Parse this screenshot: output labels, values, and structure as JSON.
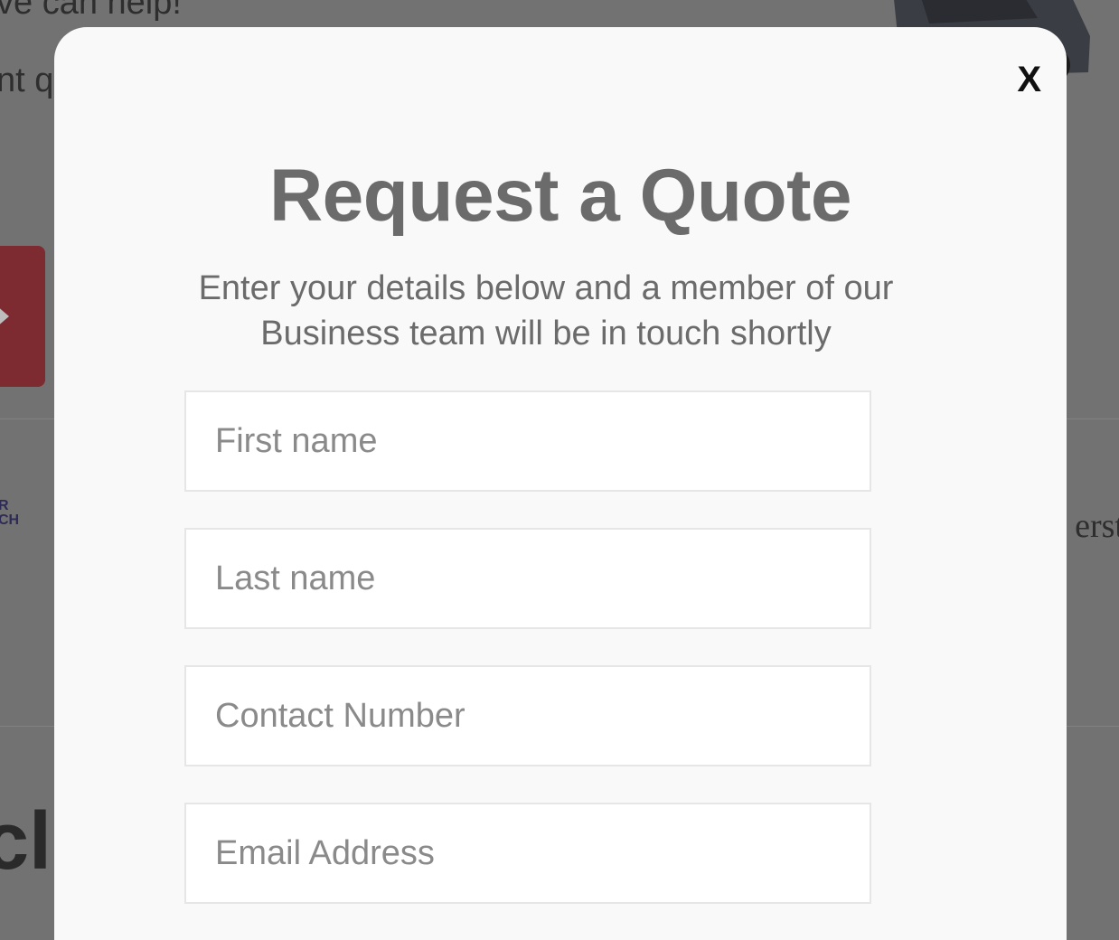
{
  "background": {
    "top_text": "ve can help!",
    "mid_text": "nt qu",
    "logo_lines": [
      "R",
      "CH"
    ],
    "right_text": "erst",
    "big_text": "cli"
  },
  "modal": {
    "close_label": "X",
    "title": "Request a Quote",
    "subtitle": "Enter your details below and a member of our Business team will be in touch shortly",
    "fields": [
      {
        "placeholder": "First name",
        "value": ""
      },
      {
        "placeholder": "Last name",
        "value": ""
      },
      {
        "placeholder": "Contact Number",
        "value": ""
      },
      {
        "placeholder": "Email Address",
        "value": ""
      }
    ]
  },
  "colors": {
    "overlay": "#727272",
    "modal_bg": "#f9f9f9",
    "heading": "#6b6b6b",
    "placeholder": "#8a8a8a",
    "accent_red": "#7d2a30"
  }
}
